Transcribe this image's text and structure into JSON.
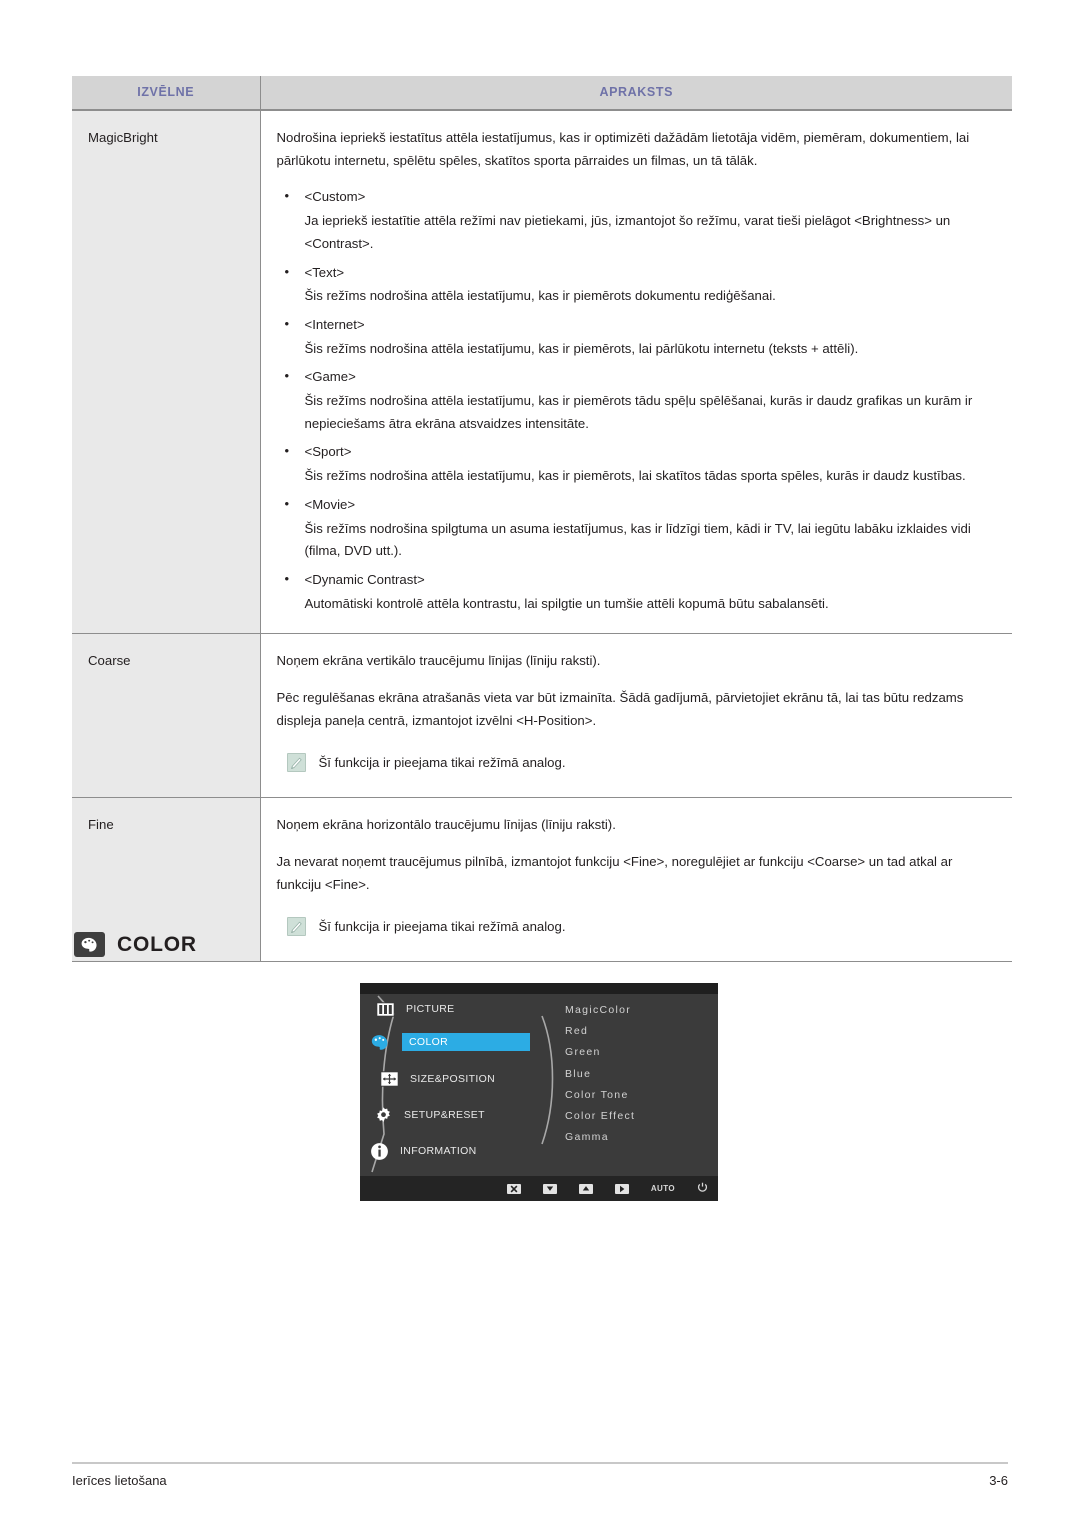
{
  "table": {
    "headers": {
      "menu": "IZVĒLNE",
      "description": "APRAKSTS"
    },
    "header_text_color": "#6f72a8",
    "header_bg_color": "#d4d4d4",
    "rows": [
      {
        "menu": "MagicBright",
        "intro": "Nodrošina iepriekš iestatītus attēla iestatījumus, kas ir optimizēti dažādām lietotāja vidēm, piemēram, dokumentiem, lai pārlūkotu internetu, spēlētu spēles, skatītos sporta pārraides un filmas, un tā tālāk.",
        "bullets": [
          {
            "title": "<Custom>",
            "body": "Ja iepriekš iestatītie attēla režīmi nav pietiekami, jūs, izmantojot šo režīmu, varat tieši pielāgot <Brightness> un <Contrast>."
          },
          {
            "title": "<Text>",
            "body": "Šis režīms nodrošina attēla iestatījumu, kas ir piemērots dokumentu rediģēšanai."
          },
          {
            "title": "<Internet>",
            "body": "Šis režīms nodrošina attēla iestatījumu, kas ir piemērots, lai pārlūkotu internetu (teksts + attēli)."
          },
          {
            "title": "<Game>",
            "body": "Šis režīms nodrošina attēla iestatījumu, kas ir piemērots tādu spēļu spēlēšanai, kurās ir daudz grafikas un kurām ir nepieciešams ātra ekrāna atsvaidzes intensitāte."
          },
          {
            "title": "<Sport>",
            "body": "Šis režīms nodrošina attēla iestatījumu, kas ir piemērots, lai skatītos tādas sporta spēles, kurās ir daudz kustības."
          },
          {
            "title": "<Movie>",
            "body": "Šis režīms nodrošina spilgtuma un asuma iestatījumus, kas ir līdzīgi tiem, kādi ir TV, lai iegūtu labāku izklaides vidi (filma, DVD utt.)."
          },
          {
            "title": "<Dynamic Contrast>",
            "body": "Automātiski kontrolē attēla kontrastu, lai spilgtie un tumšie attēli kopumā būtu sabalansēti."
          }
        ],
        "note": null
      },
      {
        "menu": "Coarse",
        "intro": "Noņem ekrāna vertikālo traucējumu līnijas (līniju raksti).",
        "paragraph": "Pēc regulēšanas ekrāna atrašanās vieta var būt izmainīta. Šādā gadījumā, pārvietojiet ekrānu tā, lai tas būtu redzams displeja paneļa centrā, izmantojot izvēlni <H-Position>.",
        "note": "Šī funkcija ir pieejama tikai režīmā analog."
      },
      {
        "menu": "Fine",
        "intro": "Noņem ekrāna horizontālo traucējumu līnijas (līniju raksti).",
        "paragraph": "Ja nevarat noņemt traucējumus pilnībā, izmantojot funkciju <Fine>, noregulējiet ar funkciju <Coarse> un tad atkal ar funkciju <Fine>.",
        "note": "Šī funkcija ir pieejama tikai režīmā analog."
      }
    ]
  },
  "section": {
    "title": "COLOR",
    "icon": "color-palette-icon"
  },
  "osd": {
    "highlight_color": "#2cace4",
    "background_color": "#3b3b3b",
    "menu_items": [
      {
        "label": "PICTURE",
        "icon": "picture-icon",
        "selected": false
      },
      {
        "label": "COLOR",
        "icon": "color-palette-icon",
        "selected": true
      },
      {
        "label": "SIZE&POSITION",
        "icon": "size-position-icon",
        "selected": false
      },
      {
        "label": "SETUP&RESET",
        "icon": "gear-icon",
        "selected": false
      },
      {
        "label": "INFORMATION",
        "icon": "info-icon",
        "selected": false
      }
    ],
    "submenu_items": [
      "MagicColor",
      "Red",
      "Green",
      "Blue",
      "Color Tone",
      "Color Effect",
      "Gamma"
    ],
    "footer_keys": [
      {
        "name": "exit-key",
        "label": ""
      },
      {
        "name": "down-key",
        "label": ""
      },
      {
        "name": "up-key",
        "label": ""
      },
      {
        "name": "enter-key",
        "label": ""
      },
      {
        "name": "auto-key",
        "label": "AUTO"
      },
      {
        "name": "power-key",
        "label": ""
      }
    ]
  },
  "footer": {
    "left": "Ierīces lietošana",
    "right": "3-6"
  }
}
